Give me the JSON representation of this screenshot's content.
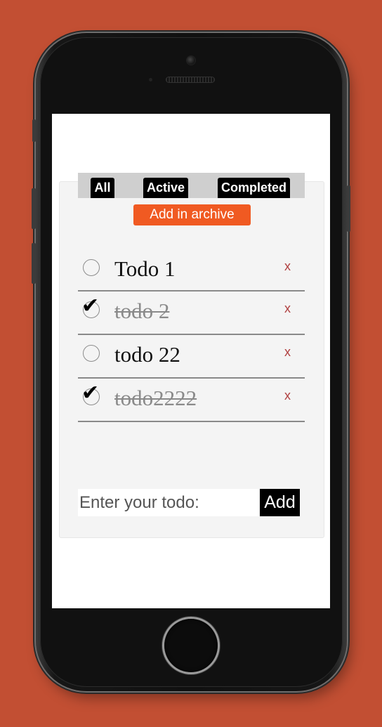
{
  "filters": {
    "all_label": "All",
    "active_label": "Active",
    "completed_label": "Completed"
  },
  "archive_label": "Add in archive",
  "todos": [
    {
      "text": "Todo 1",
      "done": false,
      "delete_label": "x"
    },
    {
      "text": "todo 2",
      "done": true,
      "delete_label": "x"
    },
    {
      "text": "todo 22",
      "done": false,
      "delete_label": "x"
    },
    {
      "text": "todo2222",
      "done": true,
      "delete_label": "x"
    }
  ],
  "input": {
    "placeholder": "Enter your todo:",
    "value": ""
  },
  "add_label": "Add",
  "colors": {
    "background": "#c24f33",
    "archive_button": "#f05a22",
    "filter_button": "#000000",
    "delete_x": "#b04040"
  },
  "icons": {
    "checked": "check-mark-icon",
    "unchecked": "empty-circle-icon"
  }
}
